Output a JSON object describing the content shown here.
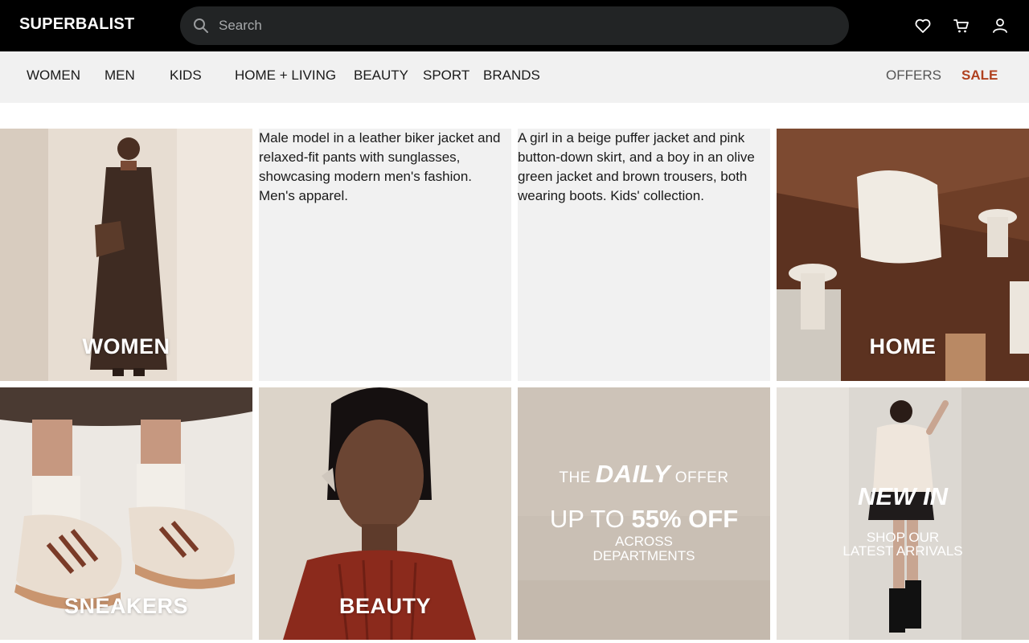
{
  "header": {
    "logo": "SUPERBALIST",
    "search_placeholder": "Search",
    "icons": [
      "heart-icon",
      "cart-icon",
      "user-icon"
    ]
  },
  "nav": {
    "items": [
      {
        "label": "WOMEN"
      },
      {
        "label": "MEN"
      },
      {
        "label": "KIDS"
      },
      {
        "label": "HOME + LIVING"
      },
      {
        "label": "BEAUTY"
      },
      {
        "label": "SPORT"
      },
      {
        "label": "BRANDS"
      }
    ],
    "offers": "OFFERS",
    "sale": "SALE",
    "sale_color": "#b0411f"
  },
  "tiles": {
    "women": {
      "label": "WOMEN"
    },
    "men": {
      "alt": "Male model in a leather biker jacket and relaxed-fit pants with sunglasses, showcasing modern men's fashion. Men's apparel."
    },
    "kids": {
      "alt": "A girl in a beige puffer jacket and pink button-down skirt, and a boy in an olive green jacket and brown trousers, both wearing boots. Kids' collection."
    },
    "home": {
      "label": "HOME"
    },
    "sneakers": {
      "label": "SNEAKERS"
    },
    "beauty": {
      "label": "BEAUTY"
    },
    "daily": {
      "the": "THE",
      "daily": "DAILY",
      "offer": "OFFER",
      "up_to": "UP TO",
      "pct": "55% OFF",
      "line1": "ACROSS",
      "line2": "DEPARTMENTS"
    },
    "newin": {
      "title": "NEW IN",
      "line1": "SHOP OUR",
      "line2": "LATEST ARRIVALS"
    }
  }
}
